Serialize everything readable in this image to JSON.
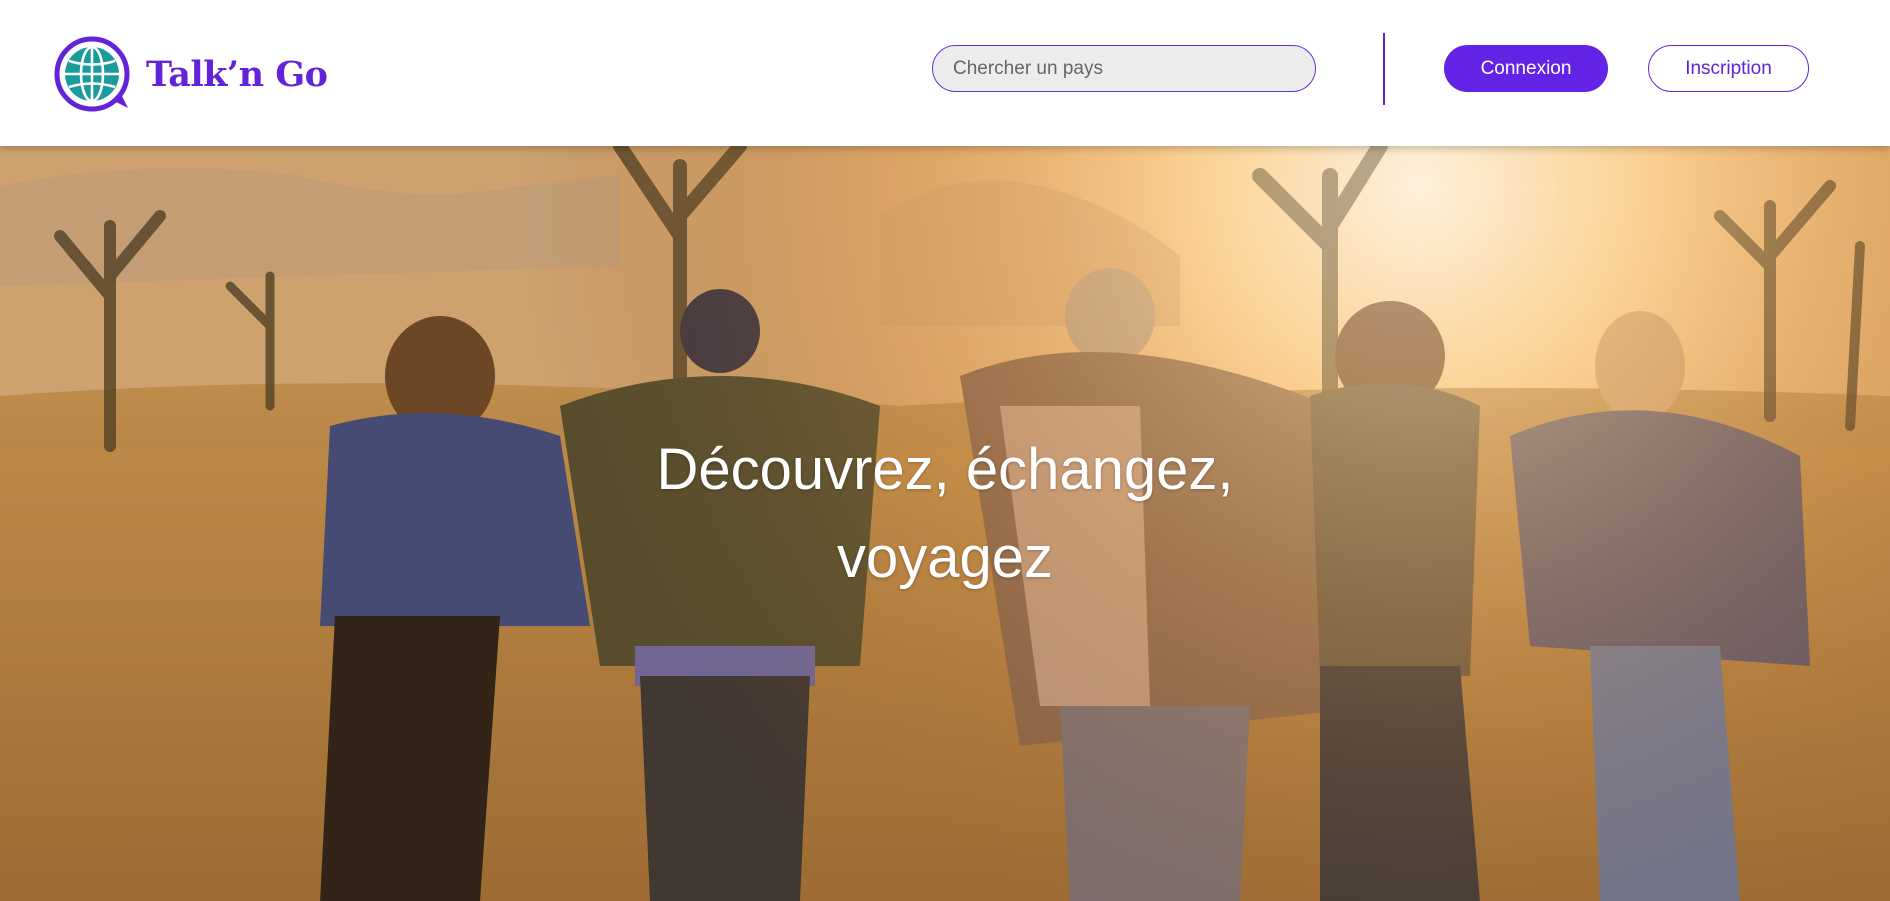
{
  "brand": {
    "name": "Talk’n Go",
    "color": "#6323d8",
    "icon": "globe-chat-icon"
  },
  "search": {
    "placeholder": "Chercher un pays"
  },
  "auth": {
    "login_label": "Connexion",
    "signup_label": "Inscription"
  },
  "hero": {
    "title": "Découvrez, échangez, voyagez",
    "image": "friends-running-desert-sunset-photo"
  }
}
